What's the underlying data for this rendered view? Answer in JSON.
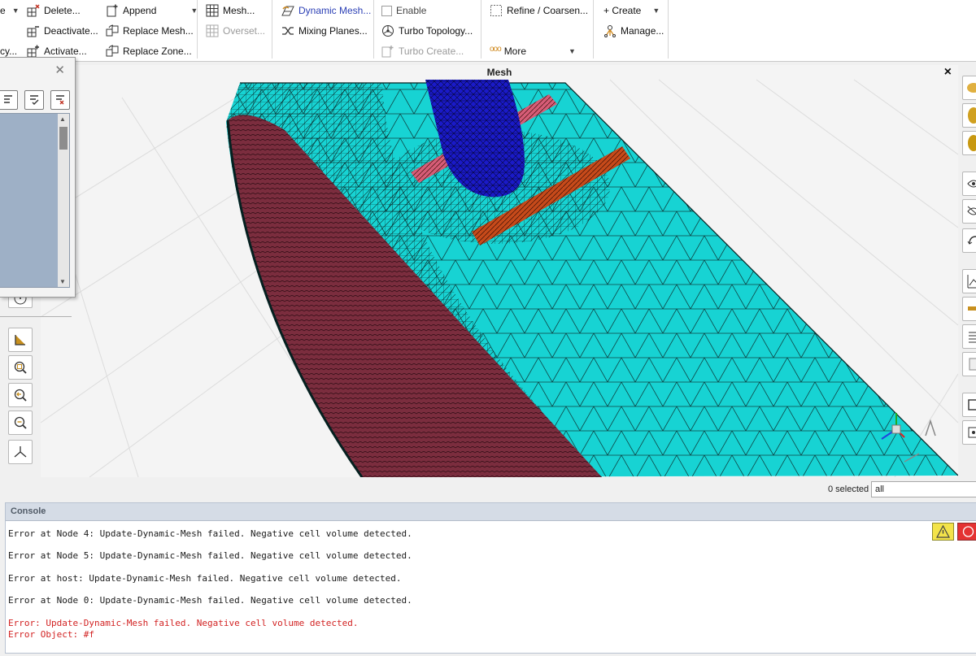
{
  "ribbon": {
    "col1": {
      "item1": "Delete...",
      "item2": "Deactivate...",
      "item3": "Activate..."
    },
    "col0_partial": {
      "item1": "e",
      "item2": "cy..."
    },
    "col2": {
      "item1": "Append",
      "item2": "Replace Mesh...",
      "item3": "Replace Zone..."
    },
    "col3": {
      "item1": "Mesh...",
      "item2": "Overset..."
    },
    "col4": {
      "item1": "Dynamic Mesh...",
      "item2": "Mixing Planes...",
      "item3": "Turbo Create..."
    },
    "col5": {
      "enable": "Enable",
      "turbo_topology": "Turbo Topology..."
    },
    "col6": {
      "refine": "Refine / Coarsen...",
      "more": "More"
    },
    "col7": {
      "create": "+ Create",
      "manage": "Manage..."
    }
  },
  "mesh_window": {
    "title": "Mesh",
    "close": "×"
  },
  "selection": {
    "count": "0 selected",
    "filter": "all"
  },
  "console": {
    "title": "Console",
    "lines": [
      "Error at Node 4: Update-Dynamic-Mesh failed. Negative cell volume detected.",
      "Error at Node 5: Update-Dynamic-Mesh failed. Negative cell volume detected.",
      "Error at host: Update-Dynamic-Mesh failed. Negative cell volume detected.",
      "Error at Node 0: Update-Dynamic-Mesh failed. Negative cell volume detected."
    ],
    "error_lines": [
      "Error: Update-Dynamic-Mesh failed. Negative cell volume detected.",
      "Error Object: #f"
    ]
  },
  "colors": {
    "mesh_cyan": "#17d3d3",
    "mesh_end_cap": "#7b2d3e",
    "rod_blue": "#1a1ac8",
    "slot_pink": "#d65c77",
    "slot_orange": "#c64a1a",
    "console_error": "#d22222"
  }
}
